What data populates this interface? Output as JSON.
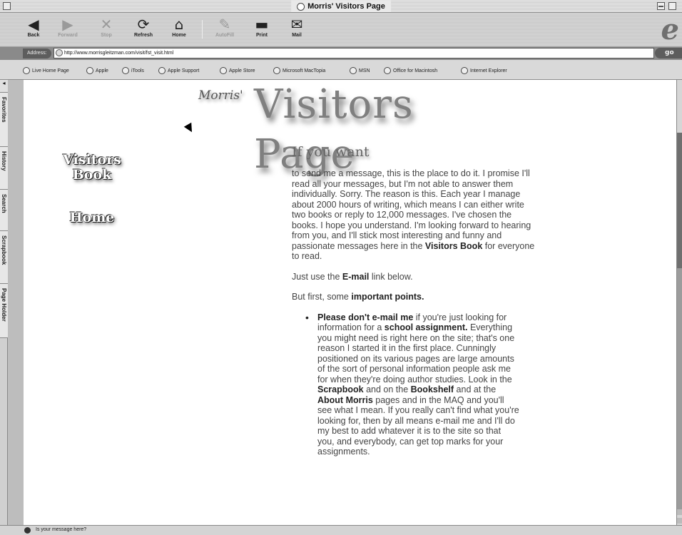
{
  "window": {
    "title": "Morris' Visitors Page"
  },
  "toolbar": {
    "back": "Back",
    "forward": "Forward",
    "stop": "Stop",
    "refresh": "Refresh",
    "home": "Home",
    "autofill": "AutoFill",
    "print": "Print",
    "mail": "Mail",
    "icons": {
      "back": "back-arrow-icon",
      "forward": "forward-arrow-icon",
      "stop": "stop-x-icon",
      "refresh": "refresh-icon",
      "home": "home-icon",
      "autofill": "autofill-icon",
      "print": "print-icon",
      "mail": "mail-icon"
    }
  },
  "address": {
    "label": "Address:",
    "url": "http://www.morrisgleitzman.com/visit/fst_visit.html",
    "go": "go"
  },
  "favorites": [
    "Live Home Page",
    "Apple",
    "iTools",
    "Apple Support",
    "Apple Store",
    "Microsoft MacTopia",
    "MSN",
    "Office for Macintosh",
    "Internet Explorer"
  ],
  "sidebar_tabs": [
    "Favorites",
    "History",
    "Search",
    "Scrapbook",
    "Page Holder"
  ],
  "page": {
    "logo_small": "Morris'",
    "logo_big": "Visitors Page",
    "nav_book": "Visitors Book",
    "nav_home": "Home",
    "heading": "If you want",
    "para1_a": "to send me a message, this is the place to do it. I promise I'll read all your messages, but I'm not able to answer them individually. Sorry. The reason is this. Each year I manage about 2000 hours of writing, which means I can either write two books or reply to 12,000 messages. I've chosen the books. I hope you understand. I'm looking forward to hearing from you, and I'll stick most interesting and funny and passionate messages here in the ",
    "para1_link": "Visitors Book",
    "para1_b": " for everyone to read.",
    "para2_a": "Just use the ",
    "para2_link": "E-mail",
    "para2_b": " link ",
    "para2_c": "below.",
    "para3_a": "But first, some ",
    "para3_bold": "important points.",
    "bullet_bold1": "Please don't e-mail me",
    "bullet_t1": " if you're just looking for information for a ",
    "bullet_bold2": "school assignment.",
    "bullet_t2": " Everything you might need is right here on the site; that's one reason I started it in the first place. Cunningly positioned on its various pages are large amounts of the sort of personal information people ask me for when they're doing author studies. Look in the ",
    "bullet_link1": "Scrapbook",
    "bullet_t3": " and on the ",
    "bullet_link2": "Bookshelf",
    "bullet_t4": " and at the ",
    "bullet_link3": "About Morris",
    "bullet_t5": " pages and in the MAQ and you'll see what I mean. If you really can't find what you're looking for, then by all means e-mail me and I'll do my best to add whatever it is to the site so that you, and everybody, can get top marks for your assignments."
  },
  "status": {
    "text": "Is your message here?"
  }
}
